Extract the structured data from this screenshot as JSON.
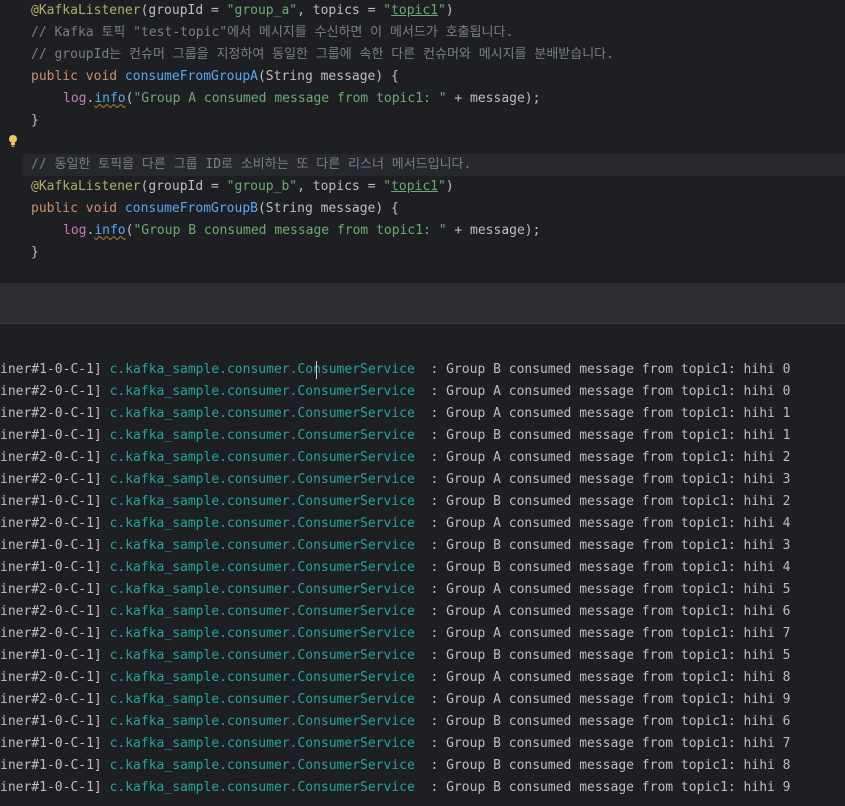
{
  "code": {
    "line1": {
      "annotation": "@KafkaListener",
      "p1": "(groupId = ",
      "group": "\"group_a\"",
      "p2": ", topics = ",
      "q1": "\"",
      "topic": "topic1",
      "q2": "\"",
      "p3": ")"
    },
    "line2": "// Kafka 토픽 \"test-topic\"에서 메시지를 수신하면 이 메서드가 호출됩니다.",
    "line3": "// groupId는 컨슈머 그룹을 지정하여 동일한 그룹에 속한 다른 컨슈머와 메시지를 분배받습니다.",
    "line4": {
      "mods": "public void ",
      "method": "consumeFromGroupA",
      "params": "(String message) {"
    },
    "line5": {
      "field": "log",
      "dot": ".",
      "call": "info",
      "lp": "(",
      "str": "\"Group A consumed message from topic1: \"",
      "rest": " + message);"
    },
    "line6": "}",
    "line7": "// 동일한 토픽을 다른 그룹 ID로 소비하는 또 다른 리스너 메서드입니다.",
    "line8": {
      "annotation": "@KafkaListener",
      "p1": "(groupId = ",
      "group": "\"group_b\"",
      "p2": ", topics = ",
      "q1": "\"",
      "topic": "topic1",
      "q2": "\"",
      "p3": ")"
    },
    "line9": {
      "mods": "public void ",
      "method": "consumeFromGroupB",
      "params": "(String message) {"
    },
    "line10": {
      "field": "log",
      "dot": ".",
      "call": "info",
      "lp": "(",
      "str": "\"Group B consumed message from topic1: \"",
      "rest": " + message);"
    },
    "line11": "}"
  },
  "icons": {
    "intention": "lightbulb-icon"
  },
  "colors": {
    "logger": "#20a5a0",
    "annotation": "#b3ae60",
    "keyword": "#cf8e6d",
    "string": "#6aab73",
    "method": "#56a8f5"
  },
  "console": {
    "logger": "c.kafka_sample.consumer.ConsumerService",
    "rows": [
      {
        "thread": "iner#1-0-C-1]",
        "msg": " : Group B consumed message from topic1: hihi 0"
      },
      {
        "thread": "iner#2-0-C-1]",
        "msg": " : Group A consumed message from topic1: hihi 0"
      },
      {
        "thread": "iner#2-0-C-1]",
        "msg": " : Group A consumed message from topic1: hihi 1"
      },
      {
        "thread": "iner#1-0-C-1]",
        "msg": " : Group B consumed message from topic1: hihi 1"
      },
      {
        "thread": "iner#2-0-C-1]",
        "msg": " : Group A consumed message from topic1: hihi 2"
      },
      {
        "thread": "iner#2-0-C-1]",
        "msg": " : Group A consumed message from topic1: hihi 3"
      },
      {
        "thread": "iner#1-0-C-1]",
        "msg": " : Group B consumed message from topic1: hihi 2"
      },
      {
        "thread": "iner#2-0-C-1]",
        "msg": " : Group A consumed message from topic1: hihi 4"
      },
      {
        "thread": "iner#1-0-C-1]",
        "msg": " : Group B consumed message from topic1: hihi 3"
      },
      {
        "thread": "iner#1-0-C-1]",
        "msg": " : Group B consumed message from topic1: hihi 4"
      },
      {
        "thread": "iner#2-0-C-1]",
        "msg": " : Group A consumed message from topic1: hihi 5"
      },
      {
        "thread": "iner#2-0-C-1]",
        "msg": " : Group A consumed message from topic1: hihi 6"
      },
      {
        "thread": "iner#2-0-C-1]",
        "msg": " : Group A consumed message from topic1: hihi 7"
      },
      {
        "thread": "iner#1-0-C-1]",
        "msg": " : Group B consumed message from topic1: hihi 5"
      },
      {
        "thread": "iner#2-0-C-1]",
        "msg": " : Group A consumed message from topic1: hihi 8"
      },
      {
        "thread": "iner#2-0-C-1]",
        "msg": " : Group A consumed message from topic1: hihi 9"
      },
      {
        "thread": "iner#1-0-C-1]",
        "msg": " : Group B consumed message from topic1: hihi 6"
      },
      {
        "thread": "iner#1-0-C-1]",
        "msg": " : Group B consumed message from topic1: hihi 7"
      },
      {
        "thread": "iner#1-0-C-1]",
        "msg": " : Group B consumed message from topic1: hihi 8"
      },
      {
        "thread": "iner#1-0-C-1]",
        "msg": " : Group B consumed message from topic1: hihi 9"
      }
    ]
  }
}
